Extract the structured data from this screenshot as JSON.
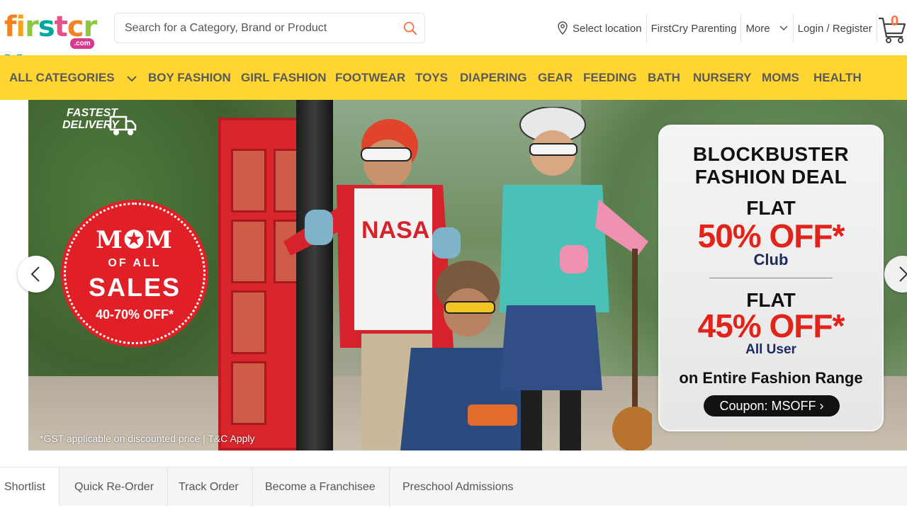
{
  "brand": {
    "logo_text": "firstcry",
    "logo_suffix": ".com"
  },
  "search": {
    "placeholder": "Search for a Category, Brand or Product"
  },
  "topnav": {
    "location": "Select location",
    "parenting": "FirstCry Parenting",
    "more": "More",
    "login": "Login / Register",
    "cart_count": "0"
  },
  "categories": {
    "all": "ALL CATEGORIES",
    "items": [
      "BOY FASHION",
      "GIRL FASHION",
      "FOOTWEAR",
      "TOYS",
      "DIAPERING",
      "GEAR",
      "FEEDING",
      "BATH",
      "NURSERY",
      "MOMS",
      "HEALTH"
    ]
  },
  "banner": {
    "fast_delivery_1": "FASTEST",
    "fast_delivery_2": "DELIVERY",
    "mom_1": "M✪M",
    "mom_2": "OF ALL",
    "mom_3": "SALES",
    "mom_4": "40-70% OFF*",
    "deal_title_1": "BLOCKBUSTER",
    "deal_title_2": "FASHION DEAL",
    "flat_1": "FLAT",
    "off_1": "50% OFF*",
    "club": "Club",
    "flat_2": "FLAT",
    "off_2": "45% OFF*",
    "all_user": "All User",
    "range": "on Entire Fashion Range",
    "coupon": "Coupon: MSOFF ›",
    "gst": "*GST applicable on discounted price | T&C Apply",
    "shirt_text": "NASA"
  },
  "bottom_links": [
    "Shortlist",
    "Quick Re-Order",
    "Track Order",
    "Become a Franchisee",
    "Preschool Admissions"
  ],
  "colors": {
    "category_bar": "#fed531",
    "accent_orange": "#ff7043",
    "sale_red": "#e11f26"
  }
}
